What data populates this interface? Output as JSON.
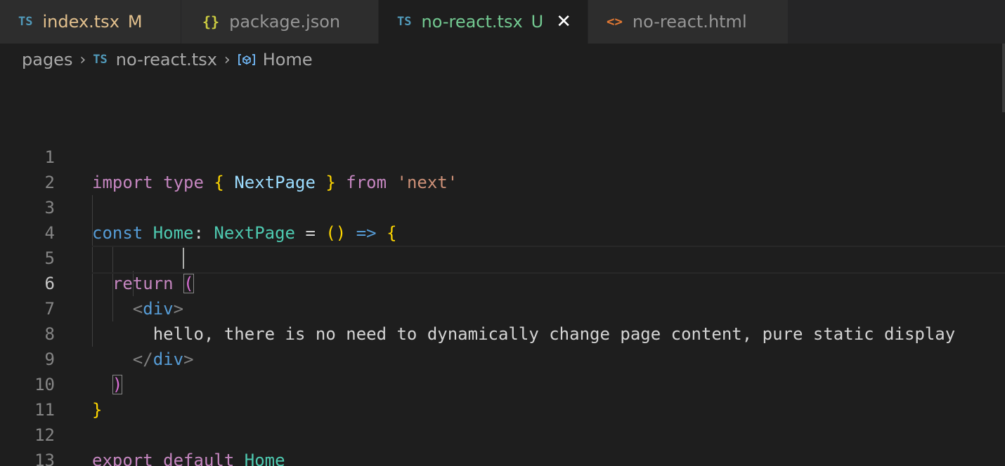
{
  "tabs": [
    {
      "icon": "TS",
      "label": "index.tsx",
      "badge": "M"
    },
    {
      "icon": "{}",
      "label": "package.json",
      "badge": ""
    },
    {
      "icon": "TS",
      "label": "no-react.tsx",
      "badge": "U",
      "close": "✕"
    },
    {
      "icon": "<>",
      "label": "no-react.html",
      "badge": ""
    }
  ],
  "breadcrumb": {
    "folder": "pages",
    "sep": "›",
    "file_icon": "TS",
    "file": "no-react.tsx",
    "symbol": "Home"
  },
  "editor": {
    "current_line": 6,
    "line_numbers": [
      "1",
      "2",
      "3",
      "4",
      "5",
      "6",
      "7",
      "8",
      "9",
      "10",
      "11",
      "12",
      "13"
    ],
    "tokens": {
      "l1": [
        "import",
        "type",
        "{",
        "NextPage",
        "}",
        "from",
        "'next'"
      ],
      "l3": [
        "const",
        "Home",
        ":",
        "NextPage",
        "=",
        "()",
        "=>",
        "{"
      ],
      "l5": [
        "return",
        "("
      ],
      "l6": [
        "<",
        "div",
        ">"
      ],
      "l7": [
        "hello, there is no need to dynamically change page content, pure static display"
      ],
      "l8": [
        "</",
        "div",
        ">"
      ],
      "l9": [
        ")"
      ],
      "l10": [
        "}"
      ],
      "l12": [
        "export",
        "default",
        "Home"
      ]
    }
  },
  "colors": {
    "editor_bg": "#1e1e1e",
    "tab_inactive_bg": "#2d2d2d",
    "modified": "#e2c08d",
    "untracked": "#73c991",
    "ts_icon": "#519aba",
    "keyword_control": "#c586c0",
    "keyword": "#569cd6",
    "type": "#4ec9b0",
    "bracket_level1": "#ffd700",
    "bracket_level2": "#da70d6",
    "string": "#ce9178"
  }
}
